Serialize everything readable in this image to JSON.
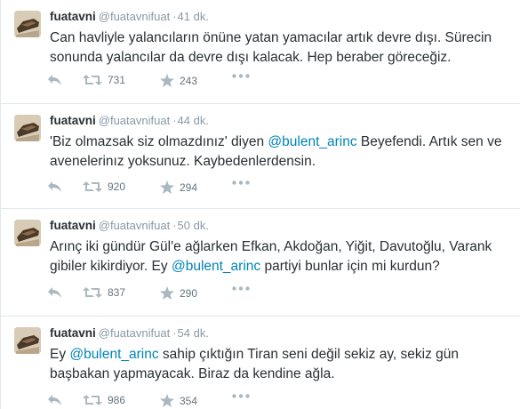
{
  "tweets": [
    {
      "fullname": "fuatavni",
      "username": "@fuatavnifuat",
      "separator": "·",
      "time": "41 dk.",
      "text_parts": [
        {
          "text": "Can havliyle yalancıların önüne yatan yamacılar artık devre dışı. Sürecin sonunda yalancılar da devre dışı kalacak. Hep beraber göreceğiz.",
          "type": "plain"
        }
      ],
      "retweets": "731",
      "favorites": "243"
    },
    {
      "fullname": "fuatavni",
      "username": "@fuatavnifuat",
      "separator": "·",
      "time": "44 dk.",
      "text_parts": [
        {
          "text": "'Biz olmazsak siz olmazdınız' diyen ",
          "type": "plain"
        },
        {
          "text": "@bulent_arinc",
          "type": "mention"
        },
        {
          "text": " Beyefendi. Artık sen ve avenelerinız yoksunuz. Kaybedenlerdensin.",
          "type": "plain"
        }
      ],
      "retweets": "920",
      "favorites": "294"
    },
    {
      "fullname": "fuatavni",
      "username": "@fuatavnifuat",
      "separator": "·",
      "time": "50 dk.",
      "text_parts": [
        {
          "text": "Arınç iki gündür Gül'e ağlarken Efkan, Akdoğan, Yiğit, Davutoğlu, Varank gibiler kikirdiyor. Ey ",
          "type": "plain"
        },
        {
          "text": "@bulent_arinc",
          "type": "mention"
        },
        {
          "text": " partiyi bunlar için mi kurdun?",
          "type": "plain"
        }
      ],
      "retweets": "837",
      "favorites": "290"
    },
    {
      "fullname": "fuatavni",
      "username": "@fuatavnifuat",
      "separator": "·",
      "time": "54 dk.",
      "text_parts": [
        {
          "text": "Ey ",
          "type": "plain"
        },
        {
          "text": "@bulent_arinc",
          "type": "mention"
        },
        {
          "text": " sahip çıktığın Tiran seni değil sekiz ay, sekiz gün başbakan yapmayacak. Biraz da kendine ağla.",
          "type": "plain"
        }
      ],
      "retweets": "986",
      "favorites": "354"
    }
  ],
  "colors": {
    "name": "#292f33",
    "meta": "#8899a6",
    "mention": "#0084b4",
    "action_icon": "#aab8c2",
    "action_count": "#66757f",
    "divider": "#e1e8ed"
  },
  "icons": {
    "reply": "reply-icon",
    "retweet": "retweet-icon",
    "favorite": "star-icon",
    "more": "more-dots-icon",
    "avatar": "avatar-image"
  }
}
